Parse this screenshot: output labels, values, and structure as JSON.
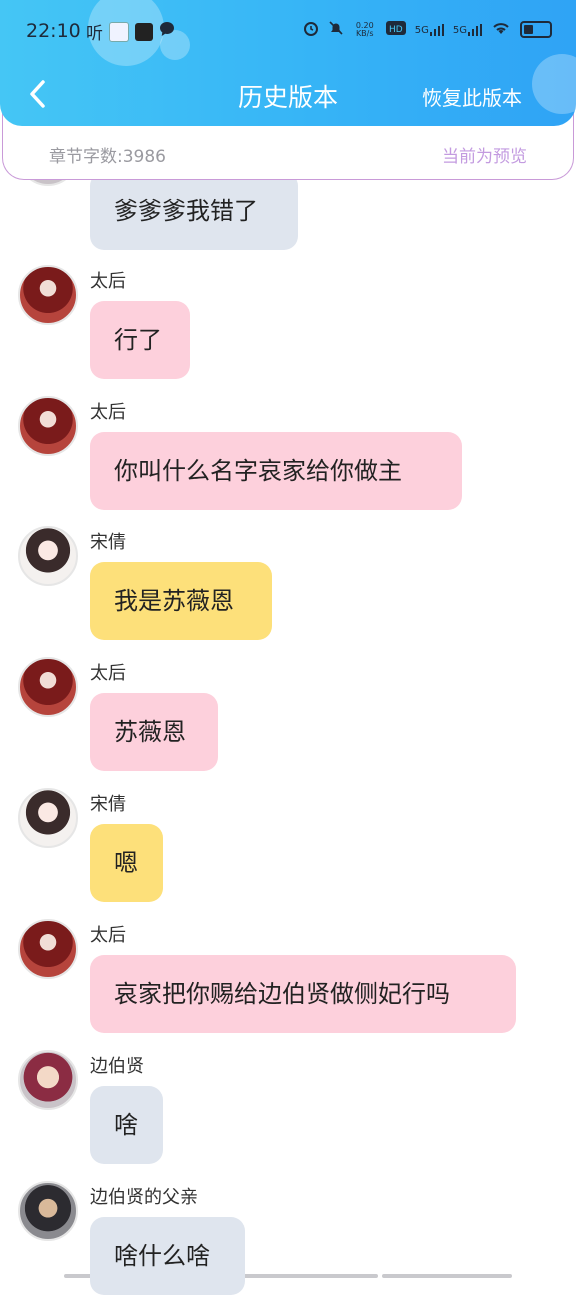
{
  "status_bar": {
    "time": "22:10",
    "app_glyph": "听",
    "net_speed": "0.20 KB/s",
    "network_1": "5G",
    "network_2": "5G"
  },
  "nav": {
    "title": "历史版本",
    "restore_label": "恢复此版本"
  },
  "info": {
    "word_count": "章节字数:3986",
    "preview_label": "当前为预览"
  },
  "messages": [
    {
      "speaker": "",
      "text": "爹爹爹我错了",
      "color": "grey"
    },
    {
      "speaker": "太后",
      "text": "行了",
      "color": "pink"
    },
    {
      "speaker": "太后",
      "text": "你叫什么名字哀家给你做主",
      "color": "pink"
    },
    {
      "speaker": "宋倩",
      "text": "我是苏薇恩",
      "color": "yellow"
    },
    {
      "speaker": "太后",
      "text": "苏薇恩",
      "color": "pink"
    },
    {
      "speaker": "宋倩",
      "text": "嗯",
      "color": "yellow"
    },
    {
      "speaker": "太后",
      "text": "哀家把你赐给边伯贤做侧妃行吗",
      "color": "pink"
    },
    {
      "speaker": "边伯贤",
      "text": "啥",
      "color": "grey"
    },
    {
      "speaker": "边伯贤的父亲",
      "text": "啥什么啥",
      "color": "grey"
    }
  ],
  "colors": {
    "header_gradient_start": "#45c6f5",
    "header_gradient_end": "#2fa3f5",
    "pink_bubble": "#fdd0dc",
    "yellow_bubble": "#fde07a",
    "grey_bubble": "#dfe5ee",
    "preview_text": "#c39be0"
  }
}
